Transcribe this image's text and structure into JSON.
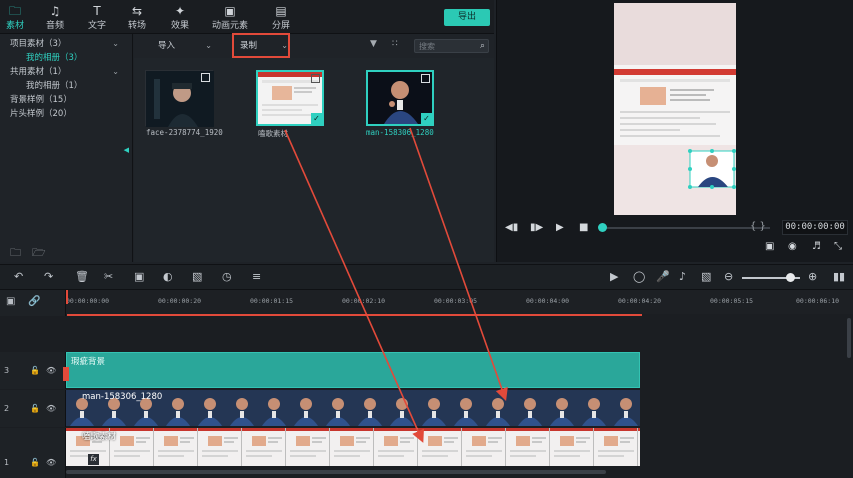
{
  "toolbar": {
    "tabs": [
      {
        "label": "素材",
        "icon": "folder-icon",
        "active": true
      },
      {
        "label": "音频",
        "icon": "music-note-icon",
        "active": false
      },
      {
        "label": "文字",
        "icon": "text-icon",
        "active": false
      },
      {
        "label": "转场",
        "icon": "transition-icon",
        "active": false
      },
      {
        "label": "效果",
        "icon": "effects-icon",
        "active": false
      },
      {
        "label": "动画元素",
        "icon": "image-icon",
        "active": false
      },
      {
        "label": "分屏",
        "icon": "split-screen-icon",
        "active": false
      }
    ],
    "export_label": "导出"
  },
  "library": {
    "items": [
      {
        "label": "项目素材（3）",
        "expanded": true
      },
      {
        "label": "我的相册（3）",
        "selected": true
      },
      {
        "label": "共用素材（1）",
        "expanded": true
      },
      {
        "label": "我的相册（1）"
      },
      {
        "label": "背景样例（15）"
      },
      {
        "label": "片头样例（20）"
      }
    ]
  },
  "media": {
    "import_label": "导入",
    "record_label": "录制",
    "search_placeholder": "搜索",
    "thumbnails": [
      {
        "caption": "face-2378774_1920",
        "selected": false
      },
      {
        "caption": "嗑歌素材",
        "selected": true
      },
      {
        "caption": "man-158306_1280",
        "selected": true
      }
    ]
  },
  "preview": {
    "timecode": "00:00:00:00",
    "bracket_label": "{ }"
  },
  "timeline": {
    "ruler_labels": [
      "00:00:00:00",
      "00:00:00:20",
      "00:00:01:15",
      "00:00:02:10",
      "00:00:03:05",
      "00:00:04:00",
      "00:00:04:20",
      "00:00:05:15",
      "00:00:06:10"
    ],
    "tracks": [
      {
        "number": "3",
        "clip_label": "瑕疵背景"
      },
      {
        "number": "2",
        "clip_label": "man-158306_1280"
      },
      {
        "number": "1",
        "clip_label": "嗑歌素材"
      }
    ],
    "fx_label": "fx"
  },
  "colors": {
    "accent": "#2fd0c0",
    "annotation": "#e24a3a",
    "background": "#1e2227"
  }
}
